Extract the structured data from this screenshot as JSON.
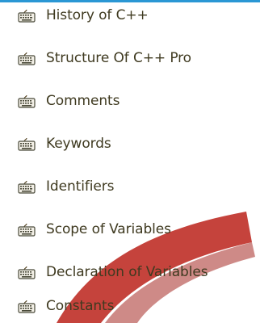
{
  "menu": {
    "items": [
      {
        "label": "History of C++",
        "icon": "keyboard-icon"
      },
      {
        "label": "Structure Of C++ Pro",
        "icon": "keyboard-icon"
      },
      {
        "label": "Comments",
        "icon": "keyboard-icon"
      },
      {
        "label": "Keywords",
        "icon": "keyboard-icon"
      },
      {
        "label": "Identifiers",
        "icon": "keyboard-icon"
      },
      {
        "label": "Scope of Variables",
        "icon": "keyboard-icon"
      },
      {
        "label": "Declaration of Variables",
        "icon": "keyboard-icon"
      },
      {
        "label": "Constants",
        "icon": "keyboard-icon"
      }
    ]
  },
  "colors": {
    "top_bar": "#2a97d4",
    "text": "#3f3a20",
    "swoosh": "#c0332b"
  }
}
